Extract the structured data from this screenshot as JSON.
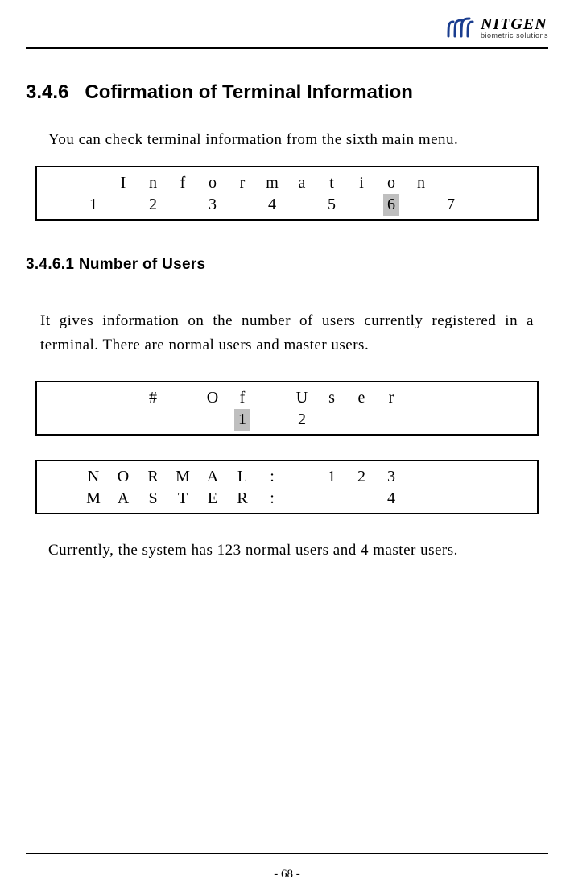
{
  "brand": {
    "name": "NITGEN",
    "tagline": "biometric solutions"
  },
  "section": {
    "number": "3.4.6",
    "title": "Cofirmation of Terminal Information"
  },
  "intro": "You can check terminal information from the sixth main menu.",
  "lcd1": {
    "row1": [
      "",
      "",
      "I",
      "n",
      "f",
      "o",
      "r",
      "m",
      "a",
      "t",
      "i",
      "o",
      "n",
      "",
      "",
      ""
    ],
    "row2": [
      "",
      "1",
      "",
      "2",
      "",
      "3",
      "",
      "4",
      "",
      "5",
      "",
      "6",
      "",
      "7",
      "",
      ""
    ],
    "highlightIndex": 11
  },
  "subsection": {
    "number": "3.4.6.1",
    "title": "Number of Users"
  },
  "para1": "It gives information on the number of users currently registered in a terminal. There are normal users and master users.",
  "lcd2": {
    "row1": [
      "",
      "",
      "",
      "#",
      "",
      "O",
      "f",
      "",
      "U",
      "s",
      "e",
      "r",
      "",
      "",
      "",
      ""
    ],
    "row2": [
      "",
      "",
      "",
      "",
      "",
      "",
      "1",
      "",
      "2",
      "",
      "",
      "",
      "",
      "",
      "",
      ""
    ],
    "highlightIndex": 6
  },
  "lcd3": {
    "row1": [
      "",
      "N",
      "O",
      "R",
      "M",
      "A",
      "L",
      ":",
      "",
      "1",
      "2",
      "3",
      "",
      "",
      "",
      ""
    ],
    "row2": [
      "",
      "M",
      "A",
      "S",
      "T",
      "E",
      "R",
      ":",
      "",
      "",
      "",
      "4",
      "",
      "",
      "",
      ""
    ]
  },
  "para2": "Currently, the system has 123 normal users and 4 master users.",
  "pageNumber": "- 68 -"
}
